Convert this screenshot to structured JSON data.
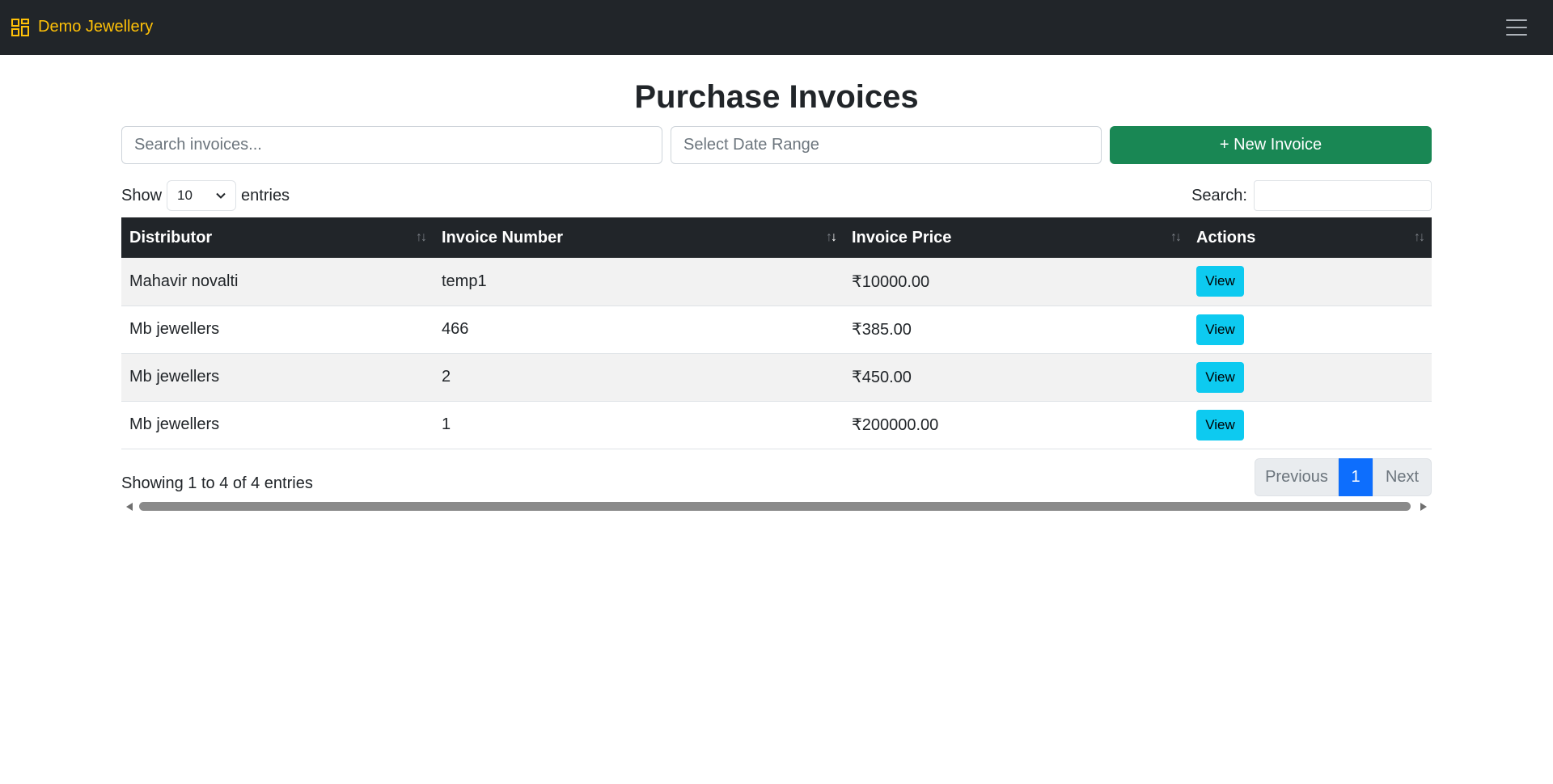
{
  "navbar": {
    "brand": "Demo Jewellery",
    "brand_icon": "dashboard-grid-icon",
    "menu_icon": "hamburger-menu-icon",
    "brand_color": "#ffc107",
    "bg_color": "#212529"
  },
  "page": {
    "title": "Purchase Invoices"
  },
  "filters": {
    "search_placeholder": "Search invoices...",
    "date_placeholder": "Select Date Range",
    "new_invoice_label": "+ New Invoice",
    "new_invoice_color": "#198754"
  },
  "table_controls": {
    "show_label": "Show",
    "entries_value": "10",
    "entries_label": "entries",
    "search_label": "Search:"
  },
  "table": {
    "columns": [
      {
        "label": "Distributor",
        "sort": "none"
      },
      {
        "label": "Invoice Number",
        "sort": "desc"
      },
      {
        "label": "Invoice Price",
        "sort": "none"
      },
      {
        "label": "Actions",
        "sort": "none"
      }
    ],
    "rows": [
      {
        "distributor": "Mahavir novalti",
        "invoice_number": "temp1",
        "price": "₹10000.00",
        "action": "View"
      },
      {
        "distributor": "Mb jewellers",
        "invoice_number": "466",
        "price": "₹385.00",
        "action": "View"
      },
      {
        "distributor": "Mb jewellers",
        "invoice_number": "2",
        "price": "₹450.00",
        "action": "View"
      },
      {
        "distributor": "Mb jewellers",
        "invoice_number": "1",
        "price": "₹200000.00",
        "action": "View"
      }
    ]
  },
  "footer": {
    "info": "Showing 1 to 4 of 4 entries",
    "pagination": {
      "previous": "Previous",
      "current": "1",
      "next": "Next"
    }
  }
}
